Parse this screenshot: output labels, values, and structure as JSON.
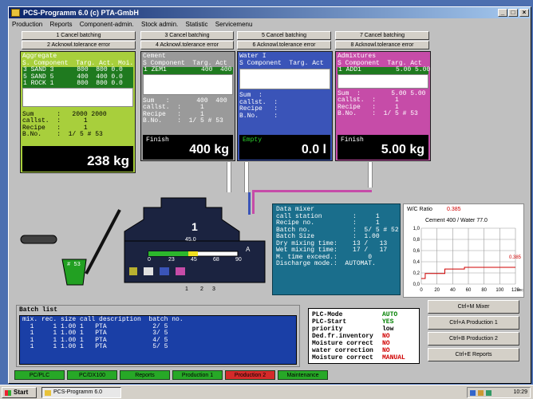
{
  "window": {
    "title": "PCS-Programm 6.0   (c) PTA-GmbH"
  },
  "menu": [
    "Production",
    "Reports",
    "Component-admin.",
    "Stock admin.",
    "Statistic",
    "Servicemenu"
  ],
  "columns": [
    {
      "cancel": "1 Cancel batching",
      "ack": "2 Acknowl.tolerance error"
    },
    {
      "cancel": "3 Cancel batching",
      "ack": "4 Acknowl.tolerance error"
    },
    {
      "cancel": "5 Cancel batching",
      "ack": "6 Acknowl.tolerance error"
    },
    {
      "cancel": "7 Cancel batching",
      "ack": "8 Acknowl.tolerance error"
    }
  ],
  "panels": {
    "aggregate": {
      "header": "Aggregate\nS. Component  Targ. Act. Moi.",
      "rows": "3 SAND 3      800  800 0.0\n5 SAND 5      400  400 0.0\n1 ROCK 1      800  800 0.0",
      "sum": "Sum      :   2000 2000\ncallst.  :      1\nRecipe   :      1\nB.No.    :  1/ 5 # 53",
      "status": "",
      "value": "238 kg",
      "color": "#a8cf3c"
    },
    "cement": {
      "header": "Cement\nS Component  Targ. Act",
      "rows": "1 ZEM1         400  400",
      "sum": "Sum   :       400  400\ncallst.  :     1\nRecipe   :     1\nB.No.    :  1/ 5 # 53",
      "status": "Finish",
      "value": "400 kg",
      "color": "#9a9a9a"
    },
    "water": {
      "header": "Water I\nS Component  Targ. Act",
      "rows": "",
      "sum": "Sum  :\ncallst.  :\nRecipe   :\nB.No.    :",
      "status": "Empty",
      "value": "0.0 l",
      "color": "#3a54b8"
    },
    "admix": {
      "header": "Admixtures\nS Component  Targ. Act",
      "rows": "1 ADD1         5.00 5.00",
      "sum": "Sum  :        5.00 5.00\ncallst.  :     1\nRecipe   :     1\nB.No.    :  1/ 5 # 53",
      "status": "Finish",
      "value": "5.00 kg",
      "color": "#c64ca8"
    }
  },
  "mixer_info": {
    "title": "Data mixer",
    "lines": "call station        :     1\nRecipe no.          :     1\nBatch no.           :  5/ 5 # 52\nBatch Size          :  1.00\nDry mixing time:    13 /   13\nWet mixing time:    17 /   17\nM. time exceed.:        0\nDischarge mode.:  AUTOMAT."
  },
  "mixer": {
    "number": "1",
    "scale_value": "45.0",
    "ticks": [
      "0",
      "23",
      "45",
      "68",
      "90"
    ],
    "gate_letter": "A",
    "gate_numbers": [
      "1",
      "2",
      "3"
    ],
    "skip_label": "# 53"
  },
  "wc_chart": {
    "title_label": "W/C Ratio",
    "title_value": "0.385",
    "subtitle": "Cement 400 / Water 77.0",
    "x_unit": "sec",
    "right_value": "0.385",
    "chart_data": {
      "type": "line",
      "x_ticks": [
        "0",
        "20",
        "40",
        "60",
        "80",
        "100",
        "120"
      ],
      "y_ticks": [
        "0,0",
        "0,2",
        "0,4",
        "0,6",
        "0,8",
        "1,0"
      ],
      "xlim": [
        0,
        120
      ],
      "ylim": [
        0,
        1.0
      ],
      "series": [
        {
          "values": [
            [
              0,
              0.1
            ],
            [
              5,
              0.1
            ],
            [
              5,
              0.19
            ],
            [
              30,
              0.19
            ],
            [
              30,
              0.27
            ],
            [
              55,
              0.27
            ],
            [
              55,
              0.3
            ],
            [
              120,
              0.3
            ]
          ]
        }
      ]
    }
  },
  "batch_list": {
    "title": "Batch list",
    "header": "mix. rec. size call description  batch no.",
    "rows": "  1     1 1.00 1   PTA            2/ 5\n  1     1 1.00 1   PTA            3/ 5\n  1     1 1.00 1   PTA            4/ 5\n  1     1 1.00 1   PTA            5/ 5"
  },
  "plc": [
    {
      "label": "PLC-Mode",
      "value": "AUTO",
      "color": "#008000"
    },
    {
      "label": "PLC-Start",
      "value": "YES",
      "color": "#008000"
    },
    {
      "label": "priority",
      "value": "low",
      "color": "#000000"
    },
    {
      "label": "Ded.fr.inventory",
      "value": "NO",
      "color": "#d00000"
    },
    {
      "label": "Moisture correct",
      "value": "NO",
      "color": "#d00000"
    },
    {
      "label": "water correction",
      "value": "NO",
      "color": "#d00000"
    },
    {
      "label": "Moisture correct",
      "value": "MANUAL",
      "color": "#d00000"
    }
  ],
  "right_buttons": [
    "Ctrl+M Mixer",
    "Ctrl+A Production 1",
    "Ctrl+B Production 2",
    "Ctrl+E Reports"
  ],
  "status_tabs": [
    {
      "label": "PC/PLC",
      "color": "#27a827"
    },
    {
      "label": "PC/DX100",
      "color": "#27a827"
    },
    {
      "label": "Reports",
      "color": "#27a827"
    },
    {
      "label": "Production 1",
      "color": "#27a827"
    },
    {
      "label": "Production 2",
      "color": "#d42a2a"
    },
    {
      "label": "Maintenance",
      "color": "#27a827"
    }
  ],
  "taskbar": {
    "start": "Start",
    "task": "PCS-Programm 6.0",
    "clock": "10:29"
  }
}
